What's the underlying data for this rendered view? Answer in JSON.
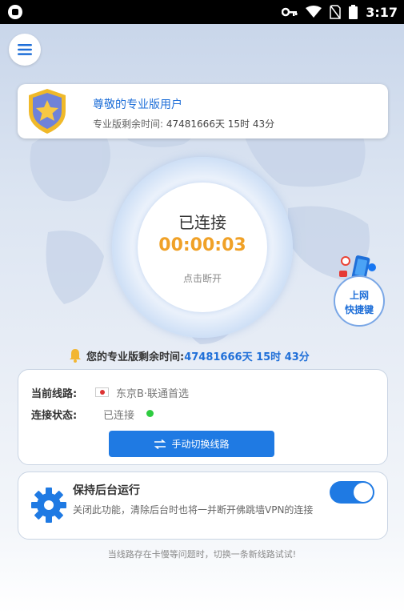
{
  "status_bar": {
    "time": "3:17",
    "icons": [
      "app-notification-icon",
      "key-icon",
      "wifi-icon",
      "no-sim-icon",
      "battery-icon"
    ]
  },
  "menu": {
    "icon": "menu-icon"
  },
  "pro_card": {
    "title": "尊敬的专业版用户",
    "remaining_label": "专业版剩余时间:",
    "remaining_value": "47481666天 15时 43分",
    "badge_icon": "star-shield-icon"
  },
  "connection": {
    "status": "已连接",
    "timer": "00:00:03",
    "tap_label": "点击断开"
  },
  "shortcut": {
    "line1": "上网",
    "line2": "快捷键"
  },
  "notice": {
    "label": "您的专业版剩余时间:",
    "value": "47481666天 15时 43分",
    "icon": "bell-icon"
  },
  "route_card": {
    "route_label": "当前线路:",
    "route_value": "东京B·联通首选",
    "status_label": "连接状态:",
    "status_value": "已连接",
    "switch_button": "手动切换线路"
  },
  "background_card": {
    "title": "保持后台运行",
    "description": "关闭此功能，清除后台时也将一并断开佛跳墙VPN的连接",
    "toggle_on": true
  },
  "tip": "当线路存在卡慢等问题时，切换一条新线路试试!",
  "colors": {
    "accent": "#1f7ae3",
    "timer": "#f0a127",
    "connected_dot": "#2ecc40"
  }
}
